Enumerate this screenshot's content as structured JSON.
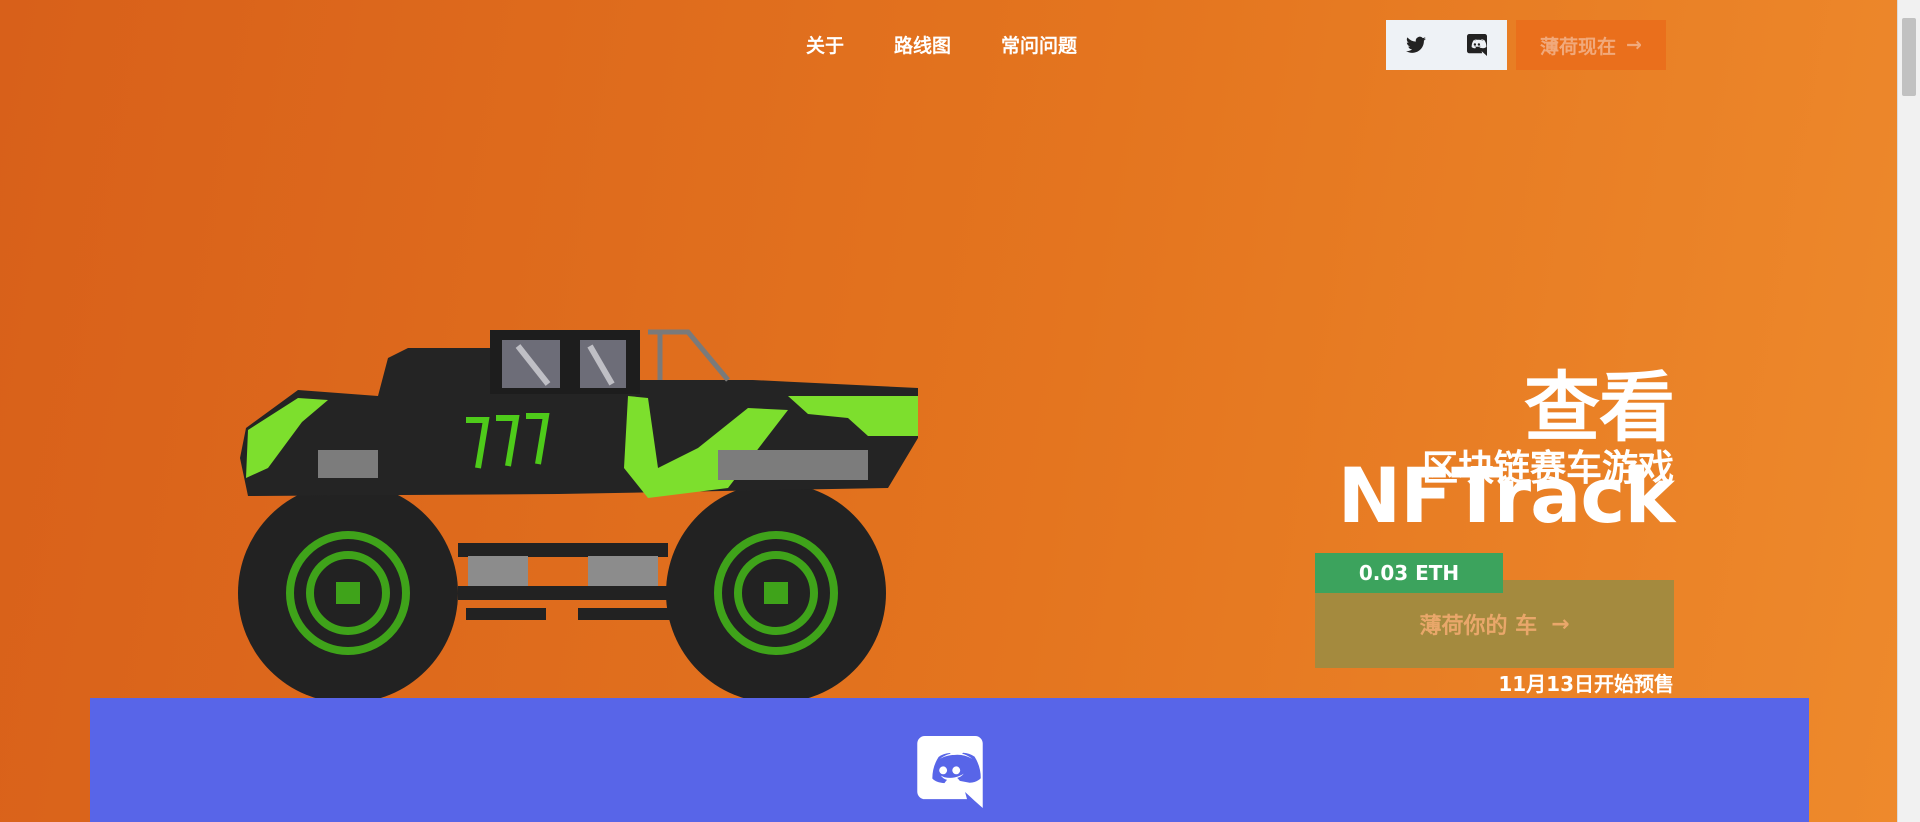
{
  "nav": {
    "items": [
      {
        "label": "关于"
      },
      {
        "label": "路线图"
      },
      {
        "label": "常问问题"
      }
    ]
  },
  "social": {
    "twitter_icon": "twitter-icon",
    "discord_icon": "discord-icon"
  },
  "header": {
    "mint_label": "薄荷现在",
    "mint_arrow": "→"
  },
  "hero": {
    "title": "查看 NFTrack",
    "subtitle": "区块链赛车游戏",
    "price": "0.03 ETH",
    "mint_label": "薄荷你的 车",
    "mint_arrow": "→",
    "presale": "11月13日开始预售"
  },
  "banner": {
    "icon": "discord-icon"
  },
  "colors": {
    "background": "#e4751f",
    "price_badge": "#3ca35d",
    "mint_button": "#a48a3e",
    "discord_banner": "#5865e8",
    "truck_accent": "#7ddf2d"
  }
}
